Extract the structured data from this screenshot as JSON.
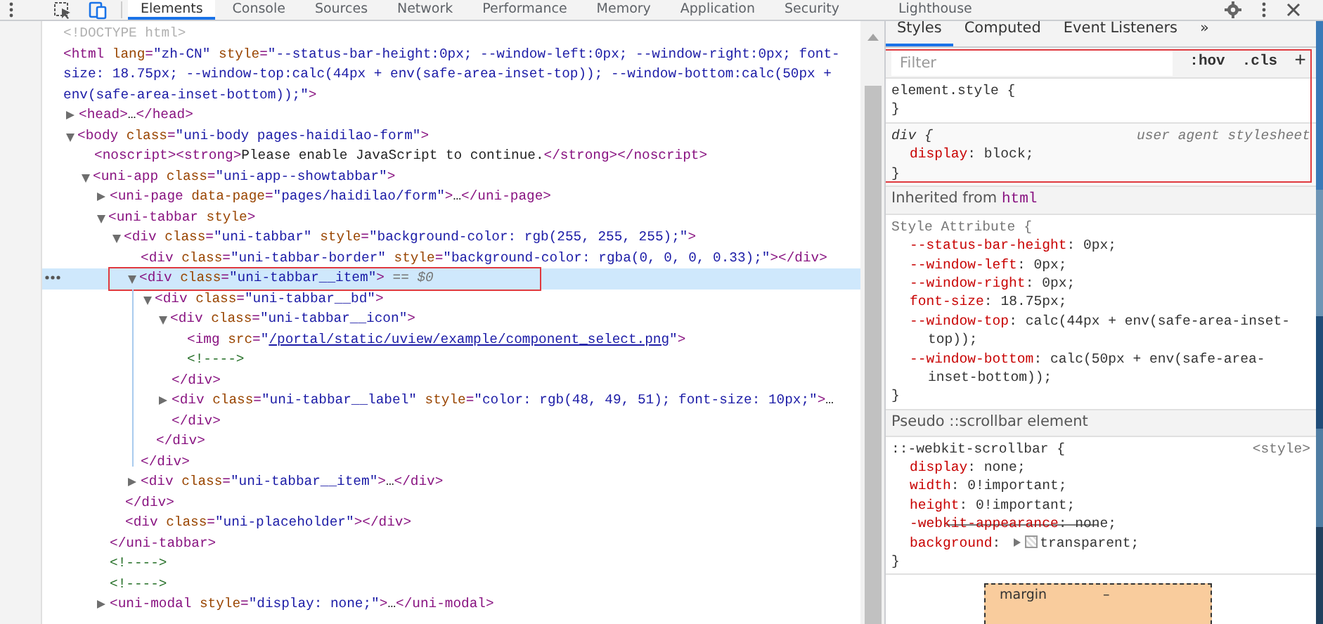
{
  "toolbar": {
    "tabs": [
      {
        "label": "Elements",
        "selected": true
      },
      {
        "label": "Console",
        "selected": false
      },
      {
        "label": "Sources",
        "selected": false
      },
      {
        "label": "Network",
        "selected": false
      },
      {
        "label": "Performance",
        "selected": false
      },
      {
        "label": "Memory",
        "selected": false
      },
      {
        "label": "Application",
        "selected": false
      },
      {
        "label": "Security",
        "selected": false
      },
      {
        "label": "Lighthouse",
        "selected": false
      }
    ]
  },
  "dom_tree": [
    {
      "selected": false,
      "tokens": [
        {
          "kind": "doctype",
          "text": "<!DOCTYPE html>"
        }
      ]
    },
    {
      "selected": false,
      "tokens": [
        {
          "kind": "tag",
          "text": "<html"
        },
        {
          "kind": "attr",
          "text": " lang"
        },
        {
          "kind": "punct",
          "text": "="
        },
        {
          "kind": "val",
          "text": "\"zh-CN\""
        },
        {
          "kind": "attr",
          "text": " style"
        },
        {
          "kind": "punct",
          "text": "="
        },
        {
          "kind": "val",
          "text": "\"--status-bar-height:0px; --window-left:0px; --window-right:0px; font-size: 18.75px; --window-top:calc(44px + env(safe-area-inset-top)); --window-bottom:calc(50px + env(safe-area-inset-bottom));\""
        },
        {
          "kind": "tag",
          "text": ">"
        }
      ],
      "children": [
        {
          "selected": false,
          "expanded": false,
          "tokens": [
            {
              "kind": "tag",
              "text": "<head>"
            },
            {
              "kind": "text",
              "text": "…"
            },
            {
              "kind": "tag",
              "text": "</head>"
            }
          ]
        },
        {
          "selected": false,
          "expanded": true,
          "tokens": [
            {
              "kind": "tag",
              "text": "<body"
            },
            {
              "kind": "attr",
              "text": " class"
            },
            {
              "kind": "punct",
              "text": "="
            },
            {
              "kind": "val",
              "text": "\"uni-body pages-haidilao-form\""
            },
            {
              "kind": "tag",
              "text": ">"
            }
          ],
          "children": [
            {
              "selected": false,
              "tokens": [
                {
                  "kind": "tag",
                  "text": "<noscript>"
                },
                {
                  "kind": "tag",
                  "text": "<strong>"
                },
                {
                  "kind": "text",
                  "text": "Please enable JavaScript to continue."
                },
                {
                  "kind": "tag",
                  "text": "</strong>"
                },
                {
                  "kind": "tag",
                  "text": "</noscript>"
                }
              ]
            },
            {
              "selected": false,
              "expanded": true,
              "tokens": [
                {
                  "kind": "tag",
                  "text": "<uni-app"
                },
                {
                  "kind": "attr",
                  "text": " class"
                },
                {
                  "kind": "punct",
                  "text": "="
                },
                {
                  "kind": "val",
                  "text": "\"uni-app--showtabbar\""
                },
                {
                  "kind": "tag",
                  "text": ">"
                }
              ],
              "children": [
                {
                  "selected": false,
                  "expanded": false,
                  "tokens": [
                    {
                      "kind": "tag",
                      "text": "<uni-page"
                    },
                    {
                      "kind": "attr",
                      "text": " data-page"
                    },
                    {
                      "kind": "punct",
                      "text": "="
                    },
                    {
                      "kind": "val",
                      "text": "\"pages/haidilao/form\""
                    },
                    {
                      "kind": "tag",
                      "text": ">"
                    },
                    {
                      "kind": "text",
                      "text": "…"
                    },
                    {
                      "kind": "tag",
                      "text": "</uni-page>"
                    }
                  ]
                },
                {
                  "selected": false,
                  "expanded": true,
                  "tokens": [
                    {
                      "kind": "tag",
                      "text": "<uni-tabbar"
                    },
                    {
                      "kind": "attr",
                      "text": " style"
                    },
                    {
                      "kind": "tag",
                      "text": ">"
                    }
                  ],
                  "closing": [
                    {
                      "kind": "tag",
                      "text": "</uni-tabbar>"
                    }
                  ],
                  "children": [
                    {
                      "selected": false,
                      "expanded": true,
                      "tokens": [
                        {
                          "kind": "tag",
                          "text": "<div"
                        },
                        {
                          "kind": "attr",
                          "text": " class"
                        },
                        {
                          "kind": "punct",
                          "text": "="
                        },
                        {
                          "kind": "val",
                          "text": "\"uni-tabbar\""
                        },
                        {
                          "kind": "attr",
                          "text": " style"
                        },
                        {
                          "kind": "punct",
                          "text": "="
                        },
                        {
                          "kind": "val",
                          "text": "\"background-color: rgb(255, 255, 255);\""
                        },
                        {
                          "kind": "tag",
                          "text": ">"
                        }
                      ],
                      "closing": [
                        {
                          "kind": "tag",
                          "text": "</div>"
                        }
                      ],
                      "children": [
                        {
                          "selected": false,
                          "tokens": [
                            {
                              "kind": "tag",
                              "text": "<div"
                            },
                            {
                              "kind": "attr",
                              "text": " class"
                            },
                            {
                              "kind": "punct",
                              "text": "="
                            },
                            {
                              "kind": "val",
                              "text": "\"uni-tabbar-border\""
                            },
                            {
                              "kind": "attr",
                              "text": " style"
                            },
                            {
                              "kind": "punct",
                              "text": "="
                            },
                            {
                              "kind": "val",
                              "text": "\"background-color: rgba(0, 0, 0, 0.33);\""
                            },
                            {
                              "kind": "tag",
                              "text": "></div>"
                            }
                          ]
                        },
                        {
                          "selected": true,
                          "annotated": true,
                          "expanded": true,
                          "tokens": [
                            {
                              "kind": "tag",
                              "text": "<div"
                            },
                            {
                              "kind": "attr",
                              "text": " class"
                            },
                            {
                              "kind": "punct",
                              "text": "="
                            },
                            {
                              "kind": "val",
                              "text": "\"uni-tabbar__item\""
                            },
                            {
                              "kind": "tag",
                              "text": ">"
                            },
                            {
                              "kind": "ref",
                              "text": " == $0"
                            }
                          ],
                          "closing": [
                            {
                              "kind": "tag",
                              "text": "</div>"
                            }
                          ],
                          "children": [
                            {
                              "selected": false,
                              "expanded": true,
                              "tokens": [
                                {
                                  "kind": "tag",
                                  "text": "<div"
                                },
                                {
                                  "kind": "attr",
                                  "text": " class"
                                },
                                {
                                  "kind": "punct",
                                  "text": "="
                                },
                                {
                                  "kind": "val",
                                  "text": "\"uni-tabbar__bd\""
                                },
                                {
                                  "kind": "tag",
                                  "text": ">"
                                }
                              ],
                              "closing": [
                                {
                                  "kind": "tag",
                                  "text": "</div>"
                                }
                              ],
                              "children": [
                                {
                                  "selected": false,
                                  "expanded": true,
                                  "tokens": [
                                    {
                                      "kind": "tag",
                                      "text": "<div"
                                    },
                                    {
                                      "kind": "attr",
                                      "text": " class"
                                    },
                                    {
                                      "kind": "punct",
                                      "text": "="
                                    },
                                    {
                                      "kind": "val",
                                      "text": "\"uni-tabbar__icon\""
                                    },
                                    {
                                      "kind": "tag",
                                      "text": ">"
                                    }
                                  ],
                                  "closing": [
                                    {
                                      "kind": "tag",
                                      "text": "</div>"
                                    }
                                  ],
                                  "children": [
                                    {
                                      "selected": false,
                                      "tokens": [
                                        {
                                          "kind": "tag",
                                          "text": "<img"
                                        },
                                        {
                                          "kind": "attr",
                                          "text": " src"
                                        },
                                        {
                                          "kind": "punct",
                                          "text": "="
                                        },
                                        {
                                          "kind": "val",
                                          "text": "\""
                                        },
                                        {
                                          "kind": "link",
                                          "text": "/portal/static/uview/example/component_select.png"
                                        },
                                        {
                                          "kind": "val",
                                          "text": "\""
                                        },
                                        {
                                          "kind": "tag",
                                          "text": ">"
                                        }
                                      ]
                                    },
                                    {
                                      "selected": false,
                                      "tokens": [
                                        {
                                          "kind": "comment",
                                          "text": "<!---->"
                                        }
                                      ]
                                    }
                                  ]
                                },
                                {
                                  "selected": false,
                                  "expanded": false,
                                  "tokens": [
                                    {
                                      "kind": "tag",
                                      "text": "<div"
                                    },
                                    {
                                      "kind": "attr",
                                      "text": " class"
                                    },
                                    {
                                      "kind": "punct",
                                      "text": "="
                                    },
                                    {
                                      "kind": "val",
                                      "text": "\"uni-tabbar__label\""
                                    },
                                    {
                                      "kind": "attr",
                                      "text": " style"
                                    },
                                    {
                                      "kind": "punct",
                                      "text": "="
                                    },
                                    {
                                      "kind": "val",
                                      "text": "\"color: rgb(48, 49, 51); font-size: 10px;\""
                                    },
                                    {
                                      "kind": "tag",
                                      "text": ">"
                                    },
                                    {
                                      "kind": "text",
                                      "text": "…"
                                    },
                                    {
                                      "kind": "tag",
                                      "text": "</div>"
                                    }
                                  ]
                                }
                              ]
                            }
                          ]
                        },
                        {
                          "selected": false,
                          "expanded": false,
                          "tokens": [
                            {
                              "kind": "tag",
                              "text": "<div"
                            },
                            {
                              "kind": "attr",
                              "text": " class"
                            },
                            {
                              "kind": "punct",
                              "text": "="
                            },
                            {
                              "kind": "val",
                              "text": "\"uni-tabbar__item\""
                            },
                            {
                              "kind": "tag",
                              "text": ">"
                            },
                            {
                              "kind": "text",
                              "text": "…"
                            },
                            {
                              "kind": "tag",
                              "text": "</div>"
                            }
                          ]
                        }
                      ]
                    },
                    {
                      "selected": false,
                      "tokens": [
                        {
                          "kind": "tag",
                          "text": "<div"
                        },
                        {
                          "kind": "attr",
                          "text": " class"
                        },
                        {
                          "kind": "punct",
                          "text": "="
                        },
                        {
                          "kind": "val",
                          "text": "\"uni-placeholder\""
                        },
                        {
                          "kind": "tag",
                          "text": "></div>"
                        }
                      ]
                    }
                  ]
                },
                {
                  "selected": false,
                  "tokens": [
                    {
                      "kind": "comment",
                      "text": "<!---->"
                    }
                  ]
                },
                {
                  "selected": false,
                  "tokens": [
                    {
                      "kind": "comment",
                      "text": "<!---->"
                    }
                  ]
                },
                {
                  "selected": false,
                  "expanded": false,
                  "tokens": [
                    {
                      "kind": "tag",
                      "text": "<uni-modal"
                    },
                    {
                      "kind": "attr",
                      "text": " style"
                    },
                    {
                      "kind": "punct",
                      "text": "="
                    },
                    {
                      "kind": "val",
                      "text": "\"display: none;\""
                    },
                    {
                      "kind": "tag",
                      "text": ">"
                    },
                    {
                      "kind": "text",
                      "text": "…"
                    },
                    {
                      "kind": "tag",
                      "text": "</uni-modal>"
                    }
                  ]
                }
              ]
            }
          ]
        }
      ]
    }
  ],
  "styles_pane": {
    "tabs": [
      {
        "label": "Styles",
        "selected": true
      },
      {
        "label": "Computed",
        "selected": false
      },
      {
        "label": "Event Listeners",
        "selected": false
      }
    ],
    "more_tabs": "»",
    "filter": {
      "placeholder": "Filter",
      "framed": true
    },
    "annotated": true,
    "filter_buttons": [
      ":hov",
      ".cls",
      "+"
    ],
    "sections": [
      {
        "kind": "rule",
        "framed": true,
        "selector": "element.style {",
        "closing": "}"
      },
      {
        "kind": "ua_rule",
        "framed": true,
        "selector": "div {",
        "source": "user agent stylesheet",
        "closing": "}",
        "props": [
          {
            "name": "display",
            "separator": ": ",
            "value": "block;",
            "overridden": false
          }
        ]
      },
      {
        "kind": "header",
        "text": "Inherited from",
        "tag": "html"
      },
      {
        "kind": "attribute_rule",
        "selector": "Style Attribute {",
        "closing": "}",
        "props": [
          {
            "name": "--status-bar-height",
            "separator": ": ",
            "value": "0px;",
            "overridden": false
          },
          {
            "name": "--window-left",
            "separator": ": ",
            "value": "0px;",
            "overridden": false
          },
          {
            "name": "--window-right",
            "separator": ": ",
            "value": "0px;",
            "overridden": false
          },
          {
            "name": "font-size",
            "separator": ": ",
            "value": "18.75px;",
            "overridden": false
          },
          {
            "name": "--window-top",
            "separator": ": ",
            "value": "calc(44px + env(safe-area-inset-top));",
            "overridden": false
          },
          {
            "name": "--window-bottom",
            "separator": ": ",
            "value": "calc(50px + env(safe-area-inset-bottom));",
            "overridden": false
          }
        ]
      },
      {
        "kind": "header",
        "text": "Pseudo ::scrollbar element"
      },
      {
        "kind": "rule",
        "selector": "::-webkit-scrollbar {",
        "source": "<style>",
        "closing": "}",
        "props": [
          {
            "name": "display",
            "separator": ": ",
            "value": "none;",
            "overridden": false
          },
          {
            "name": "width",
            "separator": ": ",
            "value": "0!important;",
            "overridden": false
          },
          {
            "name": "height",
            "separator": ": ",
            "value": "0!important;",
            "overridden": false
          },
          {
            "name": "-webkit-appearance",
            "separator": ": ",
            "value": "none;",
            "overridden": true
          },
          {
            "name": "background",
            "separator": ": ",
            "value": "transparent;",
            "overridden": false,
            "swatch": true
          }
        ]
      },
      {
        "kind": "box_model",
        "label": "margin",
        "value": "–"
      }
    ]
  }
}
